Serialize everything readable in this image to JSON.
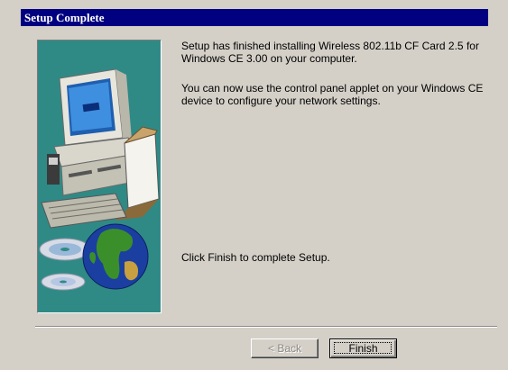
{
  "window": {
    "title": "Setup Complete"
  },
  "messages": {
    "line1": "Setup has finished installing Wireless 802.11b CF Card 2.5 for Windows CE 3.00 on your computer.",
    "line2": "You can now use the control panel applet on your Windows CE device to configure your network settings.",
    "line3": "Click Finish to complete Setup."
  },
  "buttons": {
    "back_label": "< Back",
    "finish_label": "Finish"
  },
  "colors": {
    "titlebar": "#000080",
    "dialog": "#d4d0c8",
    "art_background": "#2f8a86"
  },
  "icons": [
    "computer-illustration-icon",
    "compact-disc-icon",
    "globe-icon"
  ]
}
